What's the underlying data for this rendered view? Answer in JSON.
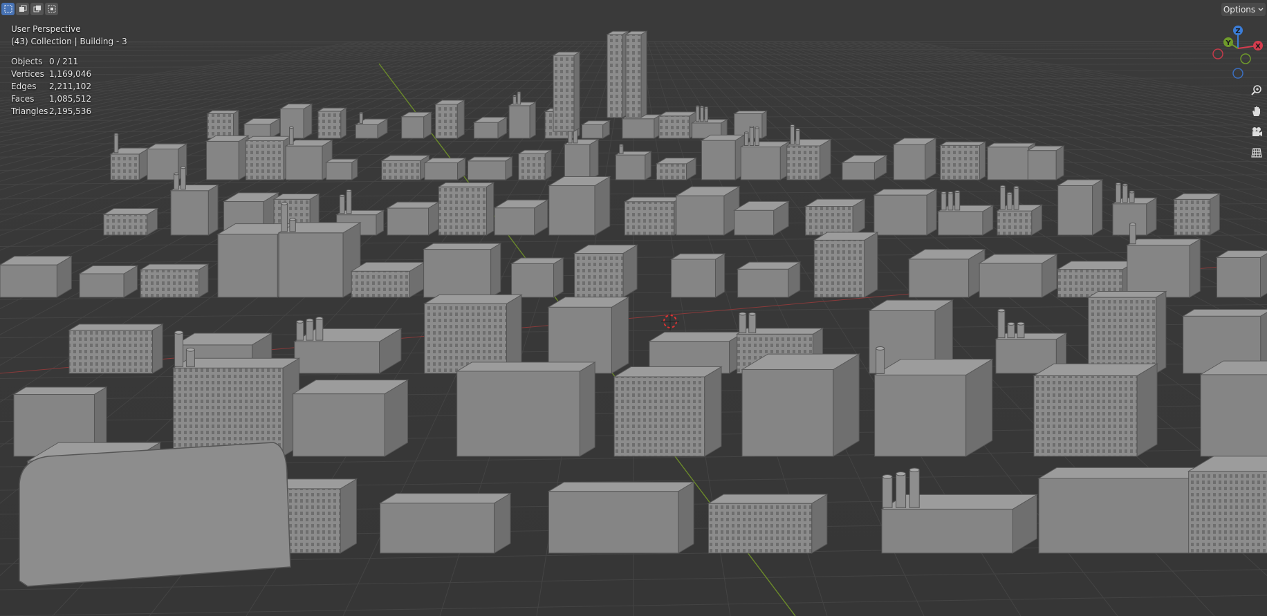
{
  "header": {
    "select_modes": [
      {
        "name": "select-box",
        "active": true
      },
      {
        "name": "extend",
        "active": false
      },
      {
        "name": "subtract",
        "active": false
      },
      {
        "name": "intersect",
        "active": false
      }
    ],
    "options_label": "Options"
  },
  "overlay": {
    "view_name": "User Perspective",
    "collection": "(43) Collection | Building - 3",
    "stats": [
      {
        "label": "Objects",
        "value": "0 / 211"
      },
      {
        "label": "Vertices",
        "value": "1,169,046"
      },
      {
        "label": "Edges",
        "value": "2,211,102"
      },
      {
        "label": "Faces",
        "value": "1,085,512"
      },
      {
        "label": "Triangles",
        "value": "2,195,536"
      }
    ]
  },
  "gizmo": {
    "z_label": "Z",
    "y_label": "Y",
    "x_label": "X",
    "colors": {
      "x": "#d63c4e",
      "y": "#6f9a2b",
      "z": "#3b7dd8"
    }
  },
  "nav_tools": [
    "zoom-icon",
    "pan-hand-icon",
    "camera-view-icon",
    "ortho-grid-icon"
  ],
  "colors": {
    "background": "#393939",
    "grid": "#454545",
    "building": "#8a8a8a",
    "accent": "#4772b3"
  }
}
